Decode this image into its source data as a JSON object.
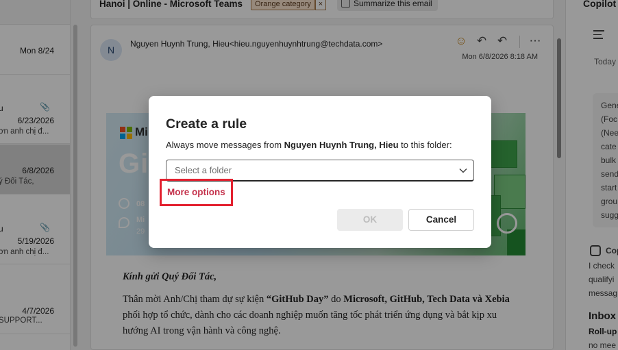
{
  "message_list": {
    "items": [
      {
        "sender": "",
        "date": "Mon 8/24",
        "preview": "",
        "attachment": false
      },
      {
        "sender": "u",
        "date": "6/23/2026",
        "preview": "ơn anh chị đ...",
        "attachment": true
      },
      {
        "sender": "",
        "date": "6/8/2026",
        "preview": "ý Đối Tác,",
        "attachment": false,
        "selected": true
      },
      {
        "sender": "u",
        "date": "5/19/2026",
        "preview": "ơn anh chị đ...",
        "attachment": true
      },
      {
        "sender": "",
        "date": "4/7/2026",
        "preview": "SUPPORT...",
        "attachment": false
      }
    ]
  },
  "header": {
    "subject": "Hanoi | Online - Microsoft Teams",
    "category": "Orange category",
    "category_remove": "×",
    "summarize_label": "Summarize this email"
  },
  "email": {
    "avatar_initial": "N",
    "from": "Nguyen Huynh Trung, Hieu<hieu.nguyenhuynhtrung@techdata.com>",
    "date": "Mon 6/8/2026 8:18 AM",
    "banner": {
      "brand": "Mi",
      "headline": "Git",
      "time_text": "08",
      "place_text": "Mi",
      "place_sub": "29"
    },
    "greeting": "Kính gửi Quý Đối Tác,",
    "para_intro": "Thân mời Anh/Chị tham dự sự kiện ",
    "event_name": "“GitHub Day”",
    "para_mid": " do ",
    "organizers": "Microsoft, GitHub, Tech Data và Xebia",
    "para_end": " phối hợp tổ chức, dành cho các doanh nghiệp muốn tăng tốc phát triển ứng dụng và bắt kịp xu hướng AI trong vận hành và công nghệ."
  },
  "copilot": {
    "title": "Copilot",
    "today": "Today",
    "card_lines": [
      "Gene",
      "(Foc",
      "(Nee",
      "cate",
      "bulk",
      "send",
      "start",
      "grou",
      "sugg"
    ],
    "copilot_label": "Cop",
    "lines": [
      "I check",
      "qualifyi",
      "messag"
    ],
    "inbox_title": "Inbox",
    "rollup": "Roll-up",
    "rollup_sub": "no mee"
  },
  "dialog": {
    "title": "Create a rule",
    "desc_prefix": "Always move messages from ",
    "desc_sender": "Nguyen Huynh Trung, Hieu",
    "desc_suffix": " to this folder:",
    "folder_placeholder": "Select a folder",
    "more_options": "More options",
    "ok_label": "OK",
    "cancel_label": "Cancel"
  }
}
